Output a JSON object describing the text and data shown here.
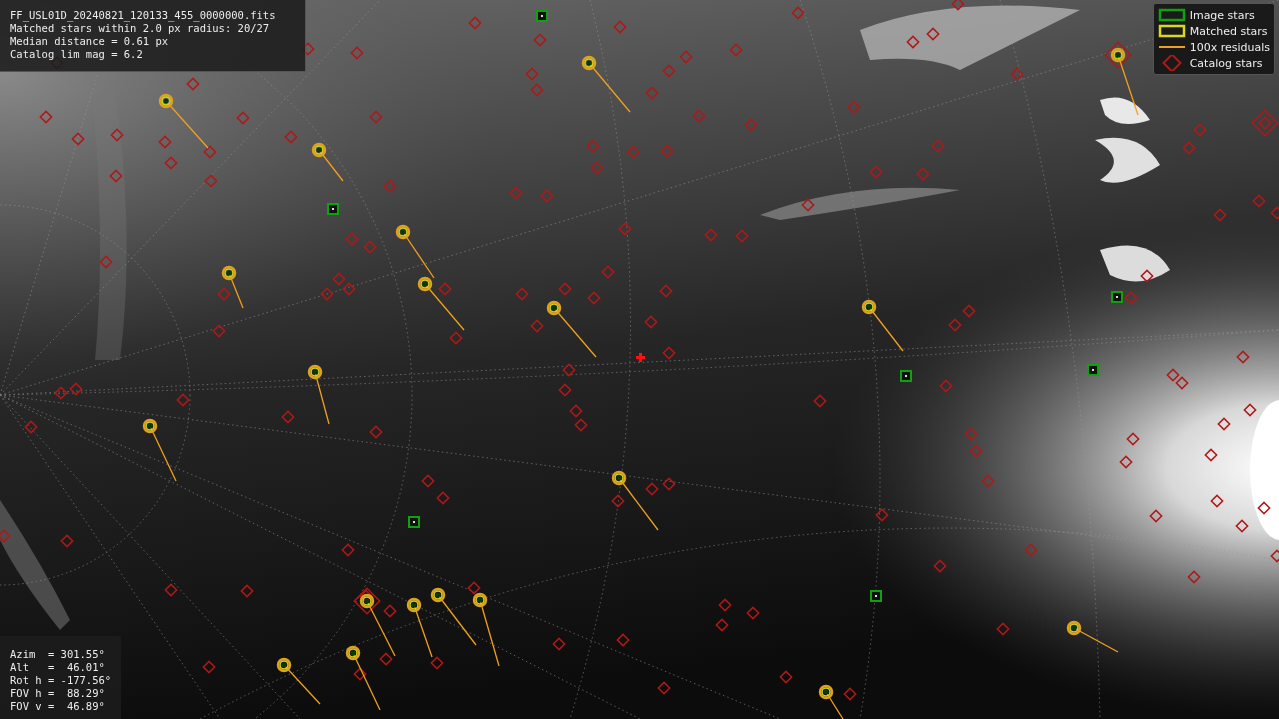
{
  "file_info": [
    "FF_USL01D_20240821_120133_455_0000000.fits",
    "Matched stars within 2.0 px radius: 20/27",
    "Median distance = 0.61 px",
    "Catalog lim mag = 6.2"
  ],
  "pointing": [
    "Azim  = 301.55°",
    "Alt   =  46.01°",
    "Rot h = -177.56°",
    "FOV h =  88.29°",
    "FOV v =  46.89°"
  ],
  "legend": [
    {
      "kind": "box",
      "label": "Image stars",
      "color": "#10a010"
    },
    {
      "kind": "box",
      "label": "Matched stars",
      "color": "#d8d820"
    },
    {
      "kind": "line",
      "label": "100x residuals",
      "color": "#f0a020"
    },
    {
      "kind": "diamond",
      "label": "Catalog stars",
      "color": "#b01818"
    }
  ]
}
